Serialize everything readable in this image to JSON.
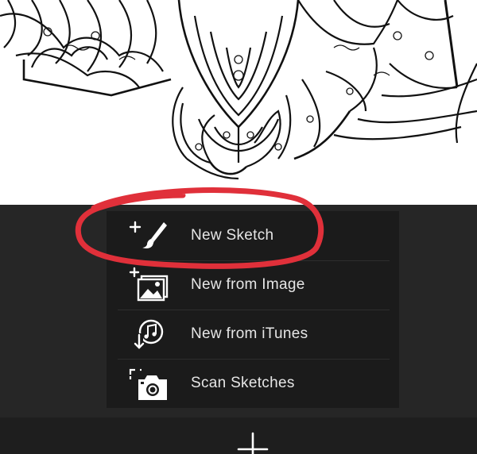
{
  "menu": {
    "items": [
      {
        "id": "new-sketch",
        "label": "New Sketch",
        "icon": "plus-brush-icon"
      },
      {
        "id": "new-from-image",
        "label": "New from Image",
        "icon": "plus-image-icon"
      },
      {
        "id": "new-from-itunes",
        "label": "New from iTunes",
        "icon": "itunes-import-icon"
      },
      {
        "id": "scan-sketches",
        "label": "Scan Sketches",
        "icon": "scan-camera-icon"
      }
    ]
  },
  "toolbar": {
    "add_icon": "plus-icon"
  },
  "colors": {
    "panel": "#262626",
    "menu": "#1b1b1b",
    "label": "#e6e6e6",
    "annotation_circle": "#e0303a"
  }
}
